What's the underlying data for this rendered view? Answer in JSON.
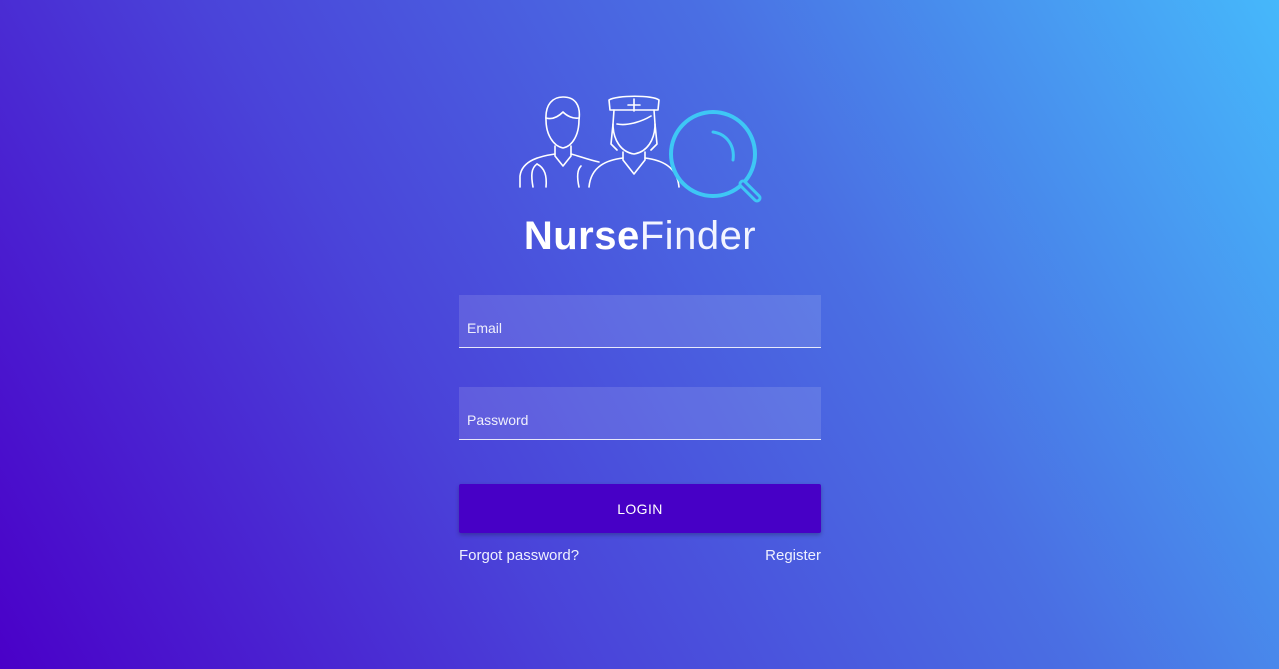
{
  "brand": {
    "name_bold": "Nurse",
    "name_light": "Finder"
  },
  "form": {
    "email_placeholder": "Email",
    "password_placeholder": "Password",
    "login_label": "LOGIN",
    "forgot_label": "Forgot password?",
    "register_label": "Register"
  },
  "colors": {
    "background_start": "#4a00c8",
    "background_end": "#46b8fb",
    "button": "#4700c6",
    "magnifier": "#3ec7f5"
  },
  "icons": {
    "logo": "nurse-finder-logo-icon",
    "doctor": "doctor-icon",
    "nurse": "nurse-icon",
    "search": "magnifier-icon"
  }
}
